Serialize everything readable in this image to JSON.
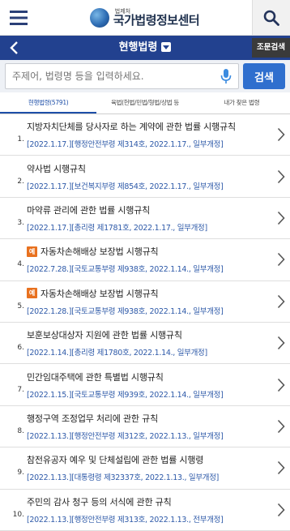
{
  "header": {
    "logo_sub": "법제처",
    "logo_main": "국가법령정보센터"
  },
  "nav": {
    "title": "현행법령",
    "jo_search": "조문검색"
  },
  "search": {
    "placeholder": "주제어, 법령명 등을 입력하세요.",
    "button_label": "검색"
  },
  "tabs": [
    {
      "label": "현행법령(5791)",
      "active": true
    },
    {
      "label": "육법(헌법/민법/형법/상법 등",
      "active": false
    },
    {
      "label": "내가 찾은 법령",
      "active": false
    }
  ],
  "items": [
    {
      "num": "1.",
      "title": "지방자치단체를 당사자로 하는 계약에 관한 법률 시행규칙",
      "badge": "",
      "meta": "[2022.1.17.][행정안전부령 제314호, 2022.1.17., 일부개정]"
    },
    {
      "num": "2.",
      "title": "약사법 시행규칙",
      "badge": "",
      "meta": "[2022.1.17.][보건복지부령 제854호, 2022.1.17., 일부개정]"
    },
    {
      "num": "3.",
      "title": "마약류 관리에 관한 법률 시행규칙",
      "badge": "",
      "meta": "[2022.1.17.][총리령 제1781호, 2022.1.17., 일부개정]"
    },
    {
      "num": "4.",
      "title": "자동차손해배상 보장법 시행규칙",
      "badge": "예",
      "meta": "[2022.7.28.][국토교통부령 제938호, 2022.1.14., 일부개정]"
    },
    {
      "num": "5.",
      "title": "자동차손해배상 보장법 시행규칙",
      "badge": "예",
      "meta": "[2022.1.28.][국토교통부령 제938호, 2022.1.14., 일부개정]"
    },
    {
      "num": "6.",
      "title": "보훈보상대상자 지원에 관한 법률 시행규칙",
      "badge": "",
      "meta": "[2022.1.14.][총리령 제1780호, 2022.1.14., 일부개정]"
    },
    {
      "num": "7.",
      "title": "민간임대주택에 관한 특별법 시행규칙",
      "badge": "",
      "meta": "[2022.1.15.][국토교통부령 제939호, 2022.1.14., 일부개정]"
    },
    {
      "num": "8.",
      "title": "행정구역 조정업무 처리에 관한 규칙",
      "badge": "",
      "meta": "[2022.1.13.][행정안전부령 제312호, 2022.1.13., 일부개정]"
    },
    {
      "num": "9.",
      "title": "참전유공자 예우 및 단체설립에 관한 법률 시행령",
      "badge": "",
      "meta": "[2022.1.13.][대통령령 제32337호, 2022.1.13., 일부개정]"
    },
    {
      "num": "10.",
      "title": "주민의 감사 청구 등의 서식에 관한 규칙",
      "badge": "",
      "meta": "[2022.1.13.][행정안전부령 제313호, 2022.1.13., 전부개정]"
    }
  ]
}
